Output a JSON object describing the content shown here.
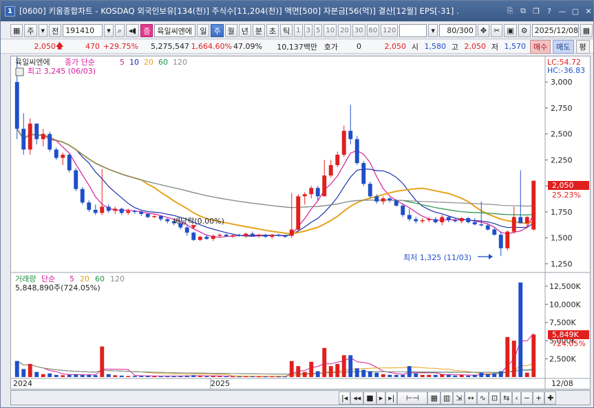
{
  "window": {
    "number": "1",
    "title": "[0600] 키움종합차트 - KOSDAQ 외국인보유[134(천)] 주식수[11,204(천)] 액면[500] 자본금[56(억)] 결산[12월] EPS[-31] .",
    "controls": [
      "⎘",
      "⧉",
      "❐",
      "?",
      "—",
      "▢",
      "✕"
    ]
  },
  "toolbar": {
    "market_label": "주",
    "scope_label": "전",
    "code_value": "191410",
    "name_badge": "증",
    "stock_name": "육일씨엔에",
    "periods": [
      "일",
      "주",
      "월",
      "년",
      "분",
      "초",
      "틱"
    ],
    "selected_period": "주",
    "interval_buttons": [
      "1",
      "3",
      "5",
      "10",
      "20",
      "30",
      "60",
      "120"
    ],
    "count_value": "80/300",
    "date_value": "2025/12/08"
  },
  "quote": {
    "price": "2,050",
    "change": "470",
    "change_pct": "+29.75%",
    "volume": "5,275,547",
    "volume_ratio": "1,664.60%",
    "turnover": "47.09%",
    "amount": "10,137백만",
    "ask_label": "호가",
    "ask_value": "0",
    "ask_price": "2,050",
    "open_label": "시",
    "open": "1,580",
    "high_label": "고",
    "high": "2,050",
    "low_label": "저",
    "low": "1,570",
    "buy_label": "매수",
    "sell_label": "매도",
    "eval_label": "평"
  },
  "price_panel": {
    "legend_name": "육일씨엔에",
    "legend_type": "종가 단순",
    "ma_labels": [
      "5",
      "10",
      "20",
      "60",
      "120"
    ],
    "ma_colors": [
      "#d81b9c",
      "#1a2fa8",
      "#e6a31c",
      "#239147",
      "#8c8c8c"
    ],
    "max_label": "최고 3,245 (06/03)",
    "min_label": "최저 1,325 (11/03)",
    "dividend_label": "배당락(0.00%)",
    "lc_label": "LC:54.72",
    "hc_label": "HC:-36.83",
    "last_price_tag": "2,050",
    "last_pct_tag": "25.23%"
  },
  "volume_panel": {
    "legend_name": "거래량",
    "legend_type": "단순",
    "ma_labels": [
      "5",
      "20",
      "60",
      "120"
    ],
    "ma_colors": [
      "#d81b9c",
      "#e6a31c",
      "#239147",
      "#8c8c8c"
    ],
    "current_label": "5,848,890주(724.05%)",
    "last_vol_tag": "5,849K",
    "last_vol_pct_tag": "724.05%"
  },
  "x_axis": {
    "labels": [
      "2024",
      "2025"
    ],
    "last_date": "12/08"
  },
  "colors": {
    "up": "#e0201e",
    "down": "#1f4fc8",
    "titlebar": "#3b5a88",
    "selected": "#3d6fc4"
  },
  "chart_data": {
    "type": "candlestick",
    "price_axis": {
      "ticks": [
        3000,
        2750,
        2500,
        2250,
        2000,
        1750,
        1500,
        1250
      ],
      "tick_labels": [
        "3,000",
        "2,750",
        "2,500",
        "2,250",
        "2,000",
        "1,750",
        "1,500",
        "1,250"
      ],
      "range": [
        1180,
        3220
      ]
    },
    "volume_axis": {
      "ticks": [
        12500,
        10000,
        7500,
        5000,
        2500
      ],
      "tick_labels": [
        "12,500K",
        "10,000K",
        "7,500K",
        "5,000K",
        "2,500K"
      ],
      "unit": "K",
      "range": [
        0,
        14000
      ]
    },
    "candles": [
      [
        3000,
        3245,
        2450,
        2550,
        2200
      ],
      [
        2550,
        2700,
        2300,
        2350,
        1100
      ],
      [
        2350,
        2650,
        2300,
        2600,
        1800
      ],
      [
        2600,
        2600,
        2400,
        2450,
        700
      ],
      [
        2450,
        2550,
        2380,
        2500,
        400
      ],
      [
        2500,
        2520,
        2330,
        2350,
        500
      ],
      [
        2350,
        2370,
        2250,
        2270,
        300
      ],
      [
        2270,
        2320,
        2200,
        2300,
        250
      ],
      [
        2300,
        2310,
        2130,
        2150,
        300
      ],
      [
        2150,
        2170,
        1950,
        1970,
        350
      ],
      [
        1970,
        1990,
        1820,
        1840,
        300
      ],
      [
        1840,
        1860,
        1750,
        1770,
        300
      ],
      [
        1770,
        1820,
        1720,
        1740,
        250
      ],
      [
        1740,
        2160,
        1720,
        1800,
        4200
      ],
      [
        1800,
        1820,
        1740,
        1760,
        400
      ],
      [
        1760,
        1800,
        1730,
        1780,
        250
      ],
      [
        1780,
        1790,
        1720,
        1740,
        200
      ],
      [
        1740,
        1780,
        1720,
        1760,
        150
      ],
      [
        1760,
        1770,
        1730,
        1750,
        150
      ],
      [
        1750,
        1760,
        1710,
        1730,
        150
      ],
      [
        1730,
        1740,
        1690,
        1700,
        150
      ],
      [
        1700,
        1720,
        1690,
        1710,
        100
      ],
      [
        1710,
        1715,
        1660,
        1680,
        120
      ],
      [
        1680,
        1690,
        1640,
        1660,
        120
      ],
      [
        1660,
        1680,
        1620,
        1640,
        150
      ],
      [
        1640,
        1660,
        1580,
        1600,
        150
      ],
      [
        1600,
        1620,
        1520,
        1550,
        200
      ],
      [
        1550,
        1560,
        1470,
        1480,
        250
      ],
      [
        1480,
        1520,
        1470,
        1510,
        150
      ],
      [
        1510,
        1530,
        1480,
        1490,
        120
      ],
      [
        1490,
        1530,
        1470,
        1520,
        150
      ],
      [
        1520,
        1540,
        1500,
        1530,
        100
      ],
      [
        1530,
        1540,
        1510,
        1515,
        100
      ],
      [
        1515,
        1530,
        1500,
        1525,
        80
      ],
      [
        1525,
        1540,
        1510,
        1520,
        80
      ],
      [
        1520,
        1550,
        1500,
        1540,
        100
      ],
      [
        1540,
        1560,
        1510,
        1520,
        100
      ],
      [
        1520,
        1540,
        1500,
        1530,
        80
      ],
      [
        1530,
        1540,
        1500,
        1510,
        80
      ],
      [
        1510,
        1540,
        1490,
        1530,
        80
      ],
      [
        1530,
        1540,
        1510,
        1520,
        70
      ],
      [
        1520,
        1530,
        1500,
        1510,
        80
      ],
      [
        1520,
        1930,
        1500,
        1580,
        2200
      ],
      [
        1580,
        1920,
        1570,
        1900,
        1500
      ],
      [
        1900,
        1940,
        1820,
        1920,
        700
      ],
      [
        1920,
        2000,
        1880,
        1980,
        2100
      ],
      [
        1980,
        2000,
        1860,
        1900,
        800
      ],
      [
        1900,
        2250,
        1900,
        2100,
        4000
      ],
      [
        2100,
        2250,
        2080,
        2200,
        1500
      ],
      [
        2200,
        2330,
        2180,
        2300,
        1800
      ],
      [
        2300,
        2580,
        2280,
        2530,
        3000
      ],
      [
        2530,
        2780,
        2400,
        2450,
        3000
      ],
      [
        2450,
        2480,
        2200,
        2220,
        1200
      ],
      [
        2220,
        2240,
        2000,
        2020,
        1000
      ],
      [
        2020,
        2040,
        1880,
        1900,
        800
      ],
      [
        1900,
        1920,
        1830,
        1850,
        600
      ],
      [
        1850,
        1900,
        1820,
        1880,
        400
      ],
      [
        1880,
        1890,
        1840,
        1860,
        300
      ],
      [
        1860,
        1870,
        1800,
        1810,
        300
      ],
      [
        1810,
        1830,
        1700,
        1720,
        300
      ],
      [
        1720,
        1780,
        1660,
        1680,
        1500
      ],
      [
        1680,
        1700,
        1640,
        1660,
        500
      ],
      [
        1660,
        1690,
        1640,
        1670,
        300
      ],
      [
        1670,
        1700,
        1650,
        1680,
        300
      ],
      [
        1680,
        1700,
        1640,
        1650,
        300
      ],
      [
        1650,
        1720,
        1620,
        1700,
        400
      ],
      [
        1700,
        1710,
        1650,
        1670,
        300
      ],
      [
        1670,
        1690,
        1650,
        1660,
        200
      ],
      [
        1660,
        1700,
        1640,
        1690,
        300
      ],
      [
        1690,
        1700,
        1640,
        1650,
        200
      ],
      [
        1650,
        1690,
        1620,
        1630,
        300
      ],
      [
        1630,
        1850,
        1610,
        1620,
        600
      ],
      [
        1620,
        1640,
        1570,
        1580,
        400
      ],
      [
        1580,
        1600,
        1520,
        1530,
        500
      ],
      [
        1530,
        1560,
        1325,
        1400,
        800
      ],
      [
        1400,
        1570,
        1380,
        1560,
        5500
      ],
      [
        1560,
        1800,
        1540,
        1700,
        5000
      ],
      [
        1700,
        2150,
        1680,
        1640,
        13000
      ],
      [
        1640,
        1710,
        1600,
        1700,
        600
      ],
      [
        1580,
        2050,
        1570,
        2050,
        5849
      ]
    ],
    "candle_fields": [
      "open",
      "high",
      "low",
      "close",
      "volume_k"
    ]
  }
}
